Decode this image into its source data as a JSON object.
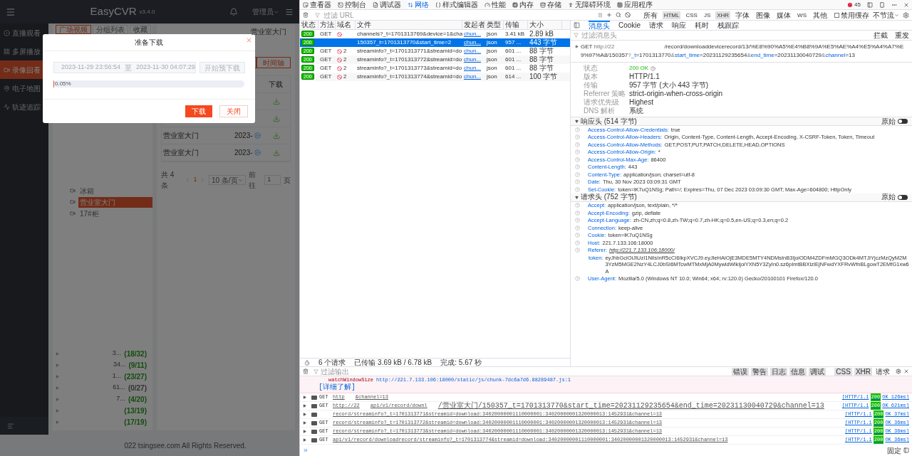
{
  "app": {
    "header": {
      "title": "EasyCVR",
      "version": "v3.4.0",
      "user": "管理员"
    },
    "sidebar": [
      {
        "label": "直播观看",
        "selected": false
      },
      {
        "label": "多屏播放",
        "selected": false
      },
      {
        "label": "录像回看",
        "selected": true
      },
      {
        "label": "电子地图",
        "selected": false
      },
      {
        "label": "轨迹追踪",
        "selected": false
      }
    ],
    "tabs": [
      {
        "label": "广场视频",
        "selected": true
      },
      {
        "label": "分组列表",
        "selected": false
      },
      {
        "label": "收藏",
        "selected": false
      }
    ],
    "tree": [
      {
        "label": "冰箱",
        "selected": false
      },
      {
        "label": "营业室大门",
        "selected": true
      },
      {
        "label": "17#柜",
        "selected": false
      }
    ],
    "groups": [
      {
        "label": "3...",
        "count": "(18/32)",
        "color": "#134d0e"
      },
      {
        "label": "34...",
        "count": "(9/11)",
        "color": "#134d0e"
      },
      {
        "label": "1...",
        "count": "(23/27)",
        "color": "#134d0e"
      },
      {
        "label": "61...",
        "count": "(0/27)",
        "color": "#333333"
      },
      {
        "label": "7...",
        "count": "(4/20)",
        "color": "#134d0e"
      },
      {
        "count": "(13/19)",
        "color": "#134d0e"
      },
      {
        "count": "(17/19)",
        "color": "#134d0e"
      }
    ],
    "channel_title": "营业室大门",
    "timeline_button": "时间轴",
    "table": {
      "columns": [
        "下载"
      ],
      "rows": [
        {
          "kind": "covered"
        },
        {
          "kind": "covered"
        },
        {
          "kind": "full",
          "name": "营业室大门",
          "time": "2023-"
        },
        {
          "kind": "full",
          "name": "营业室大门",
          "time": "2023-"
        }
      ]
    },
    "pagination": {
      "total": "共 4 条",
      "page": "1",
      "page_size": "10 条/页",
      "goto": "前往",
      "goto_value": "1",
      "unit": "页"
    },
    "footer": "022 tsingsee.com All Rights Reserved."
  },
  "dialog": {
    "title": "准备下载",
    "start": "2023-11-29 23:56:54",
    "separator": "至",
    "end": "2023-11-30 04:07:29",
    "prefetch_button": {
      "label": "开始预下载",
      "disabled": true
    },
    "progress": {
      "level": 0.0005,
      "reading": "0.05%"
    },
    "buttons": [
      {
        "label": "下载",
        "kind": "primary"
      },
      {
        "label": "关闭",
        "kind": "secondary"
      }
    ]
  },
  "devtools": {
    "tabs": [
      {
        "label": "查看器",
        "selected": false
      },
      {
        "label": "控制台",
        "selected": false
      },
      {
        "label": "调试器",
        "selected": false
      },
      {
        "label": "网络",
        "selected": true
      },
      {
        "label": "样式编辑器",
        "selected": false
      },
      {
        "label": "性能",
        "selected": false
      },
      {
        "label": "内存",
        "selected": false
      },
      {
        "label": "存储",
        "selected": false
      },
      {
        "label": "无障碍环境",
        "selected": false
      },
      {
        "label": "应用程序",
        "selected": false
      }
    ],
    "error_count": "45",
    "filter_placeholder": "过滤 URL",
    "type_filters": [
      {
        "label": "所有",
        "selected": false
      },
      {
        "label": "HTML",
        "selected": true
      },
      {
        "label": "CSS",
        "selected": false
      },
      {
        "label": "JS",
        "selected": false
      },
      {
        "label": "XHR",
        "selected": true
      },
      {
        "label": "字体",
        "selected": false
      },
      {
        "label": "图像",
        "selected": false
      },
      {
        "label": "媒体",
        "selected": false
      },
      {
        "label": "WS",
        "selected": false
      },
      {
        "label": "其他",
        "selected": false
      }
    ],
    "disable_cache": {
      "label": "禁用缓存",
      "checked": false
    },
    "throttle": "不节流",
    "network": {
      "columns": [
        "状态",
        "方法",
        "域名",
        "文件",
        "发起者",
        "类型",
        "传输",
        "大小"
      ],
      "rows": [
        {
          "status": "200",
          "method": "GET",
          "file": "channels?_t=1701313769&device=1&cha",
          "initiator": "chun...",
          "type": "json",
          "transferred": "3.41 kB",
          "size": "2.89 kB",
          "selected": false
        },
        {
          "status": "200",
          "file": "150357_t=1701313770&start_time=2",
          "initiator": "chun...",
          "type": "json",
          "transferred": "957 ...",
          "size": "443 字节",
          "selected": true
        },
        {
          "status": "200",
          "method": "GET",
          "domain": "2",
          "file": "streaminfo?_t=1701313771&streamid=do",
          "initiator": "chun...",
          "type": "json",
          "transferred": "601 ...",
          "size": "88 字节",
          "selected": false
        },
        {
          "status": "200",
          "method": "GET",
          "domain": "2",
          "file": "streaminfo?_t=1701313772&streamid=do",
          "initiator": "chun...",
          "type": "json",
          "transferred": "601 ...",
          "size": "88 字节",
          "selected": false
        },
        {
          "status": "200",
          "method": "GET",
          "domain": "2",
          "file": "streaminfo?_t=1701313773&streamid=do",
          "initiator": "chun...",
          "type": "json",
          "transferred": "601 ...",
          "size": "88 字节",
          "selected": false
        },
        {
          "status": "200",
          "method": "GET",
          "domain": "2",
          "file": "streaminfo?_t=1701313774&streamid=do",
          "initiator": "chun...",
          "type": "json",
          "transferred": "614 ...",
          "size": "100 字节",
          "selected": false
        }
      ]
    },
    "summary": {
      "requests": "6 个请求",
      "transferred": "已传输 3.69 kB / 6.78 kB",
      "finished": "完成: 5.67 秒"
    },
    "details": {
      "tabs": [
        {
          "label": "消息头",
          "selected": true
        },
        {
          "label": "Cookie",
          "selected": false
        },
        {
          "label": "请求",
          "selected": false
        },
        {
          "label": "响应",
          "selected": false
        },
        {
          "label": "耗时",
          "selected": false
        },
        {
          "label": "栈跟踪",
          "selected": false
        }
      ],
      "filter_placeholder": "过滤消息头",
      "actions": [
        "拦截",
        "重发"
      ],
      "request_line": {
        "method": "GET",
        "url_start": "http://22",
        "url_path": "/record/downloaddevicerecord/13/%E8%90%A5%E4%B8%9A%E5%AE%A4%E5%A4%A7%E9%97%A8/150357",
        "params": [
          {
            "prefix": "?",
            "name": "_t",
            "value": "=1701313770"
          },
          {
            "prefix": "&",
            "name": "start_time",
            "value": "=20231129235654"
          },
          {
            "prefix": "&",
            "name": "end_time",
            "value": "=20231130040729"
          },
          {
            "prefix": "&",
            "name": "channel",
            "value": "=13"
          }
        ]
      },
      "fields": [
        {
          "label": "状态",
          "value": "200 OK",
          "kind": "status"
        },
        {
          "label": "版本",
          "value": "HTTP/1.1",
          "kind": "plain"
        },
        {
          "label": "传输",
          "value": "957 字节 (大小 443 字节)",
          "kind": "plain"
        },
        {
          "label": "Referrer 策略",
          "value": "strict-origin-when-cross-origin",
          "kind": "plain"
        },
        {
          "label": "请求优先级",
          "value": "Highest",
          "kind": "plain"
        },
        {
          "label": "DNS 解析",
          "value": "系统",
          "kind": "plain"
        }
      ],
      "sections": [
        {
          "title": "响应头 (514 字节)",
          "raw_label": "原始",
          "raw": false,
          "items": [
            {
              "name": "Access-Control-Allow-Credentials:",
              "value": "true",
              "kind": "plain"
            },
            {
              "name": "Access-Control-Allow-Headers:",
              "value": "Origin, Content-Type, Content-Length, Accept-Encoding, X-CSRF-Token, Token, Timeout",
              "kind": "plain"
            },
            {
              "name": "Access-Control-Allow-Methods:",
              "value": "GET,POST,PUT,PATCH,DELETE,HEAD,OPTIONS",
              "kind": "plain"
            },
            {
              "name": "Access-Control-Allow-Origin:",
              "value": "*",
              "kind": "plain"
            },
            {
              "name": "Access-Control-Max-Age:",
              "value": "86400",
              "kind": "plain"
            },
            {
              "name": "Content-Length:",
              "value": "443",
              "kind": "plain"
            },
            {
              "name": "Content-Type:",
              "value": "application/json; charset=utf-8",
              "kind": "plain"
            },
            {
              "name": "Date:",
              "value": "Thu, 30 Nov 2023 03:09:31 GMT",
              "kind": "plain"
            },
            {
              "name": "Set-Cookie:",
              "value": "token=lK7uQ1NSg; Path=/; Expires=Thu, 07 Dec 2023 03:09:30 GMT; Max-Age=604800; HttpOnly",
              "kind": "plain"
            }
          ]
        },
        {
          "title": "请求头 (752 字节)",
          "raw_label": "原始",
          "raw": false,
          "items": [
            {
              "name": "Accept:",
              "value": "application/json, text/plain, */*",
              "kind": "plain"
            },
            {
              "name": "Accept-Encoding:",
              "value": "gzip, deflate",
              "kind": "plain"
            },
            {
              "name": "Accept-Language:",
              "value": "zh-CN,zh;q=0.8,zh-TW;q=0.7,zh-HK;q=0.5,en-US;q=0.3,en;q=0.2",
              "kind": "plain"
            },
            {
              "name": "Connection:",
              "value": "keep-alive",
              "kind": "plain"
            },
            {
              "name": "Cookie:",
              "value": "token=lK7uQ1NSg",
              "kind": "plain"
            },
            {
              "name": "Host:",
              "value": "221.7.133.106:18000",
              "kind": "plain"
            },
            {
              "name": "Referer:",
              "value": "http://221.7.133.106:18000/",
              "kind": "link"
            },
            {
              "name": "token:",
              "value": "eyJhbGciOiJIUzI1NiIsInR5cCI6IkpXVCJ9.eyJleHAiOjE3MDE5MTY4NDMsInB3IjoiODM4ZDFmMGQ3ODk4MTJiYjczMzQyM2M3YzM5MGE2NzY4LCJ0bSI6MTcwMTMxMjA0MywidWlkIjoiYXN5Y3ZyIn0.sz6pImtBBXlzIEjNFwdYXFRvWfnBLgowT2EMfG1xw6A",
              "kind": "continuation"
            },
            {
              "name": "User-Agent:",
              "value": "Mozilla/5.0 (Windows NT 10.0; Win64; x64; rv:120.0) Gecko/20100101 Firefox/120.0",
              "kind": "plain"
            }
          ]
        }
      ]
    }
  },
  "console": {
    "filter_placeholder": "过滤输出",
    "levels": [
      {
        "label": "错误",
        "selected": true
      },
      {
        "label": "警告",
        "selected": true
      },
      {
        "label": "日志",
        "selected": true
      },
      {
        "label": "信息",
        "selected": true
      },
      {
        "label": "调试",
        "selected": true
      }
    ],
    "categories": [
      {
        "label": "CSS",
        "selected": true
      },
      {
        "label": "XHR",
        "selected": true
      },
      {
        "label": "请求",
        "selected": false
      }
    ],
    "error": {
      "message": "watchWindowSize",
      "source": "http://221.7.133.106:18000/static/js/chunk-7dc6a7d6.88289487.js:1",
      "learn_more": "[详细了解]"
    },
    "messages": [
      {
        "method": "GET",
        "url_parts": [
          "http",
          "&channel=13"
        ],
        "protocol": "[HTTP/1.1",
        "status": "200",
        "result": "OK 126ms]"
      },
      {
        "method": "GET",
        "url_parts": [
          "http://22",
          "api/v1/record/downl",
          "/营业室大门/150357_t=1701313770&start_time=20231129235654&end_time=20231130040729&channel=13"
        ],
        "protocol": "[HTTP/1.1",
        "status": "200",
        "result": "OK 621ms]"
      },
      {
        "url_parts": [
          "record/streaminfo?_t=1701313771&streamid=download:34020000001110000001:34020000001320000013:1452931&channel=13"
        ],
        "protocol": "[HTTP/1.1",
        "status": "200",
        "result": "OK 37ms]"
      },
      {
        "method": "GET",
        "url_parts": [
          "record/streaminfo?_t=1701313772&streamid=download:34020000001110000001:34020000001320000013:1452931&channel=13"
        ],
        "protocol": "[HTTP/1.1",
        "status": "200",
        "result": "OK 36ms]"
      },
      {
        "method": "GET",
        "url_parts": [
          "record/streaminfo?_t=1701313773&streamid=download:34020000001110000001:34020000001320000013:1452931&channel=13"
        ],
        "protocol": "[HTTP/1.1",
        "status": "200",
        "result": "OK 36ms]"
      },
      {
        "method": "GET",
        "url_parts": [
          "api/v1/record/downloadrecord/streaminfo?_t=1701313774&streamid=download:34020000001110000001:34020000001320000013:1452931&channel=13"
        ],
        "protocol": "[HTTP/1.1",
        "status": "200",
        "result": "OK 36ms]"
      }
    ],
    "pin_label": "固定"
  }
}
